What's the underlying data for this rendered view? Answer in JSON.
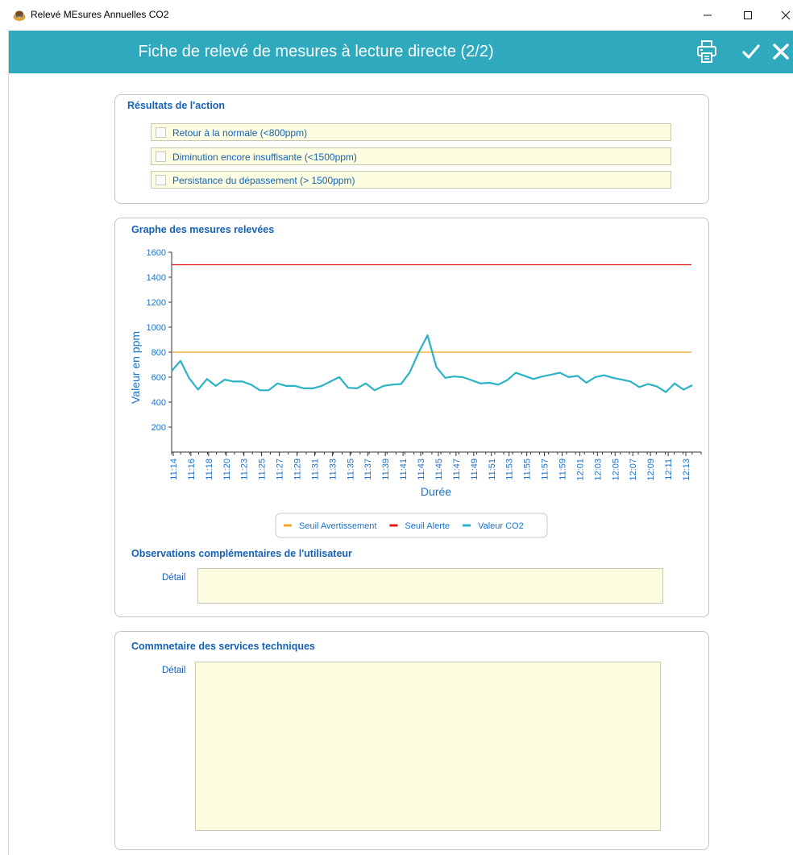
{
  "window": {
    "title": "Relevé MEsures Annuelles CO2",
    "controls": {
      "minimize": "–",
      "maximize": "☐",
      "close": "✕"
    }
  },
  "header": {
    "title": "Fiche de relevé de mesures à lecture directe   (2/2)",
    "accent": "#2fa9be",
    "buttons": [
      "printer-icon",
      "check-icon",
      "close-icon"
    ]
  },
  "results": {
    "title": "Résultats de l'action",
    "options": [
      {
        "label": "Retour à la normale (<800ppm)",
        "checked": false
      },
      {
        "label": "Diminution encore insuffisante  (<1500ppm)",
        "checked": false
      },
      {
        "label": "Persistance du dépassement (> 1500ppm)",
        "checked": false
      }
    ]
  },
  "graph_panel": {
    "title": "Graphe des mesures relevées"
  },
  "chart_data": {
    "type": "line",
    "xlabel": "Durée",
    "ylabel": "Valeur en ppm",
    "ylim": [
      0,
      1600
    ],
    "yticks": [
      200,
      400,
      600,
      800,
      1000,
      1200,
      1400,
      1600
    ],
    "xtick_labels": [
      "11:14",
      "11:16",
      "11:18",
      "11:20",
      "11:23",
      "11:25",
      "11:27",
      "11:29",
      "11:31",
      "11:33",
      "11:35",
      "11:37",
      "11:39",
      "11:41",
      "11:43",
      "11:45",
      "11:47",
      "11:49",
      "11:51",
      "11:53",
      "11:55",
      "11:57",
      "11:59",
      "12:01",
      "12:03",
      "12:05",
      "12:07",
      "12:09",
      "12:11",
      "12:13"
    ],
    "series": [
      {
        "name": "Seuil Avertissement",
        "color": "#f5a623",
        "kind": "threshold",
        "value": 800
      },
      {
        "name": "Seuil Alerte",
        "color": "#e3161a",
        "kind": "threshold",
        "value": 1500
      },
      {
        "name": "Valeur CO2",
        "color": "#2bb2c6",
        "kind": "line",
        "values": [
          650,
          730,
          590,
          500,
          585,
          530,
          580,
          565,
          565,
          540,
          495,
          495,
          550,
          530,
          530,
          510,
          510,
          530,
          565,
          600,
          515,
          510,
          550,
          495,
          530,
          540,
          545,
          640,
          800,
          935,
          680,
          595,
          605,
          600,
          575,
          550,
          555,
          540,
          575,
          635,
          610,
          585,
          605,
          620,
          635,
          600,
          610,
          555,
          600,
          615,
          595,
          580,
          565,
          520,
          545,
          525,
          480,
          550,
          500,
          535
        ]
      }
    ],
    "legend_position": "bottom",
    "grid": false
  },
  "observations": {
    "title": "Observations complémentaires de l'utilisateur",
    "detail_label": "Détail",
    "detail_value": ""
  },
  "comments": {
    "title": "Commnetaire des services techniques",
    "detail_label": "Détail",
    "detail_value": ""
  }
}
